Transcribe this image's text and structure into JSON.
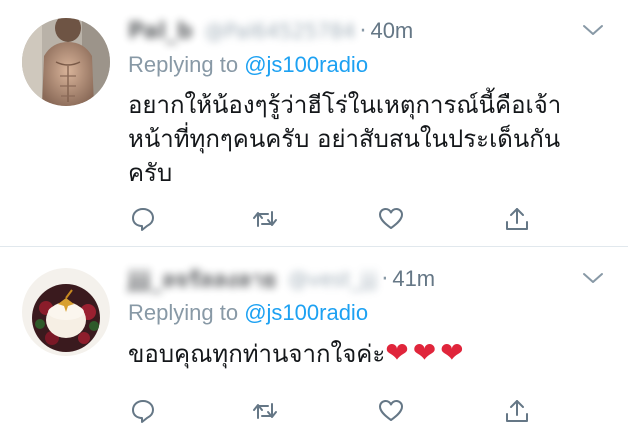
{
  "tweets": [
    {
      "display_name": "Pal_b",
      "handle": "@Pal64525784",
      "separator": "·",
      "time": "40m",
      "replying_prefix": "Replying to",
      "replying_to": "@js100radio",
      "text": "อยากให้น้องๆรู้ว่าฮีโร่ในเหตุการณ์นี้คือเจ้าหน้าที่ทุกๆคนครับ อย่าสับสนในประเด็นกันครับ",
      "hearts": ""
    },
    {
      "display_name": "jjj_ลจรัลลงลาย",
      "handle": "@vest_jjj",
      "separator": "·",
      "time": "41m",
      "replying_prefix": "Replying to",
      "replying_to": "@js100radio",
      "text": "ขอบคุณทุกท่านจากใจค่ะ",
      "hearts": "❤❤❤"
    }
  ],
  "icons": {
    "reply": "reply-icon",
    "retweet": "retweet-icon",
    "like": "like-icon",
    "share": "share-icon",
    "menu": "chevron-down-icon"
  },
  "colors": {
    "accent": "#1da1f2",
    "muted": "#8899a6",
    "text": "#14171a",
    "heart": "#e0253b"
  }
}
